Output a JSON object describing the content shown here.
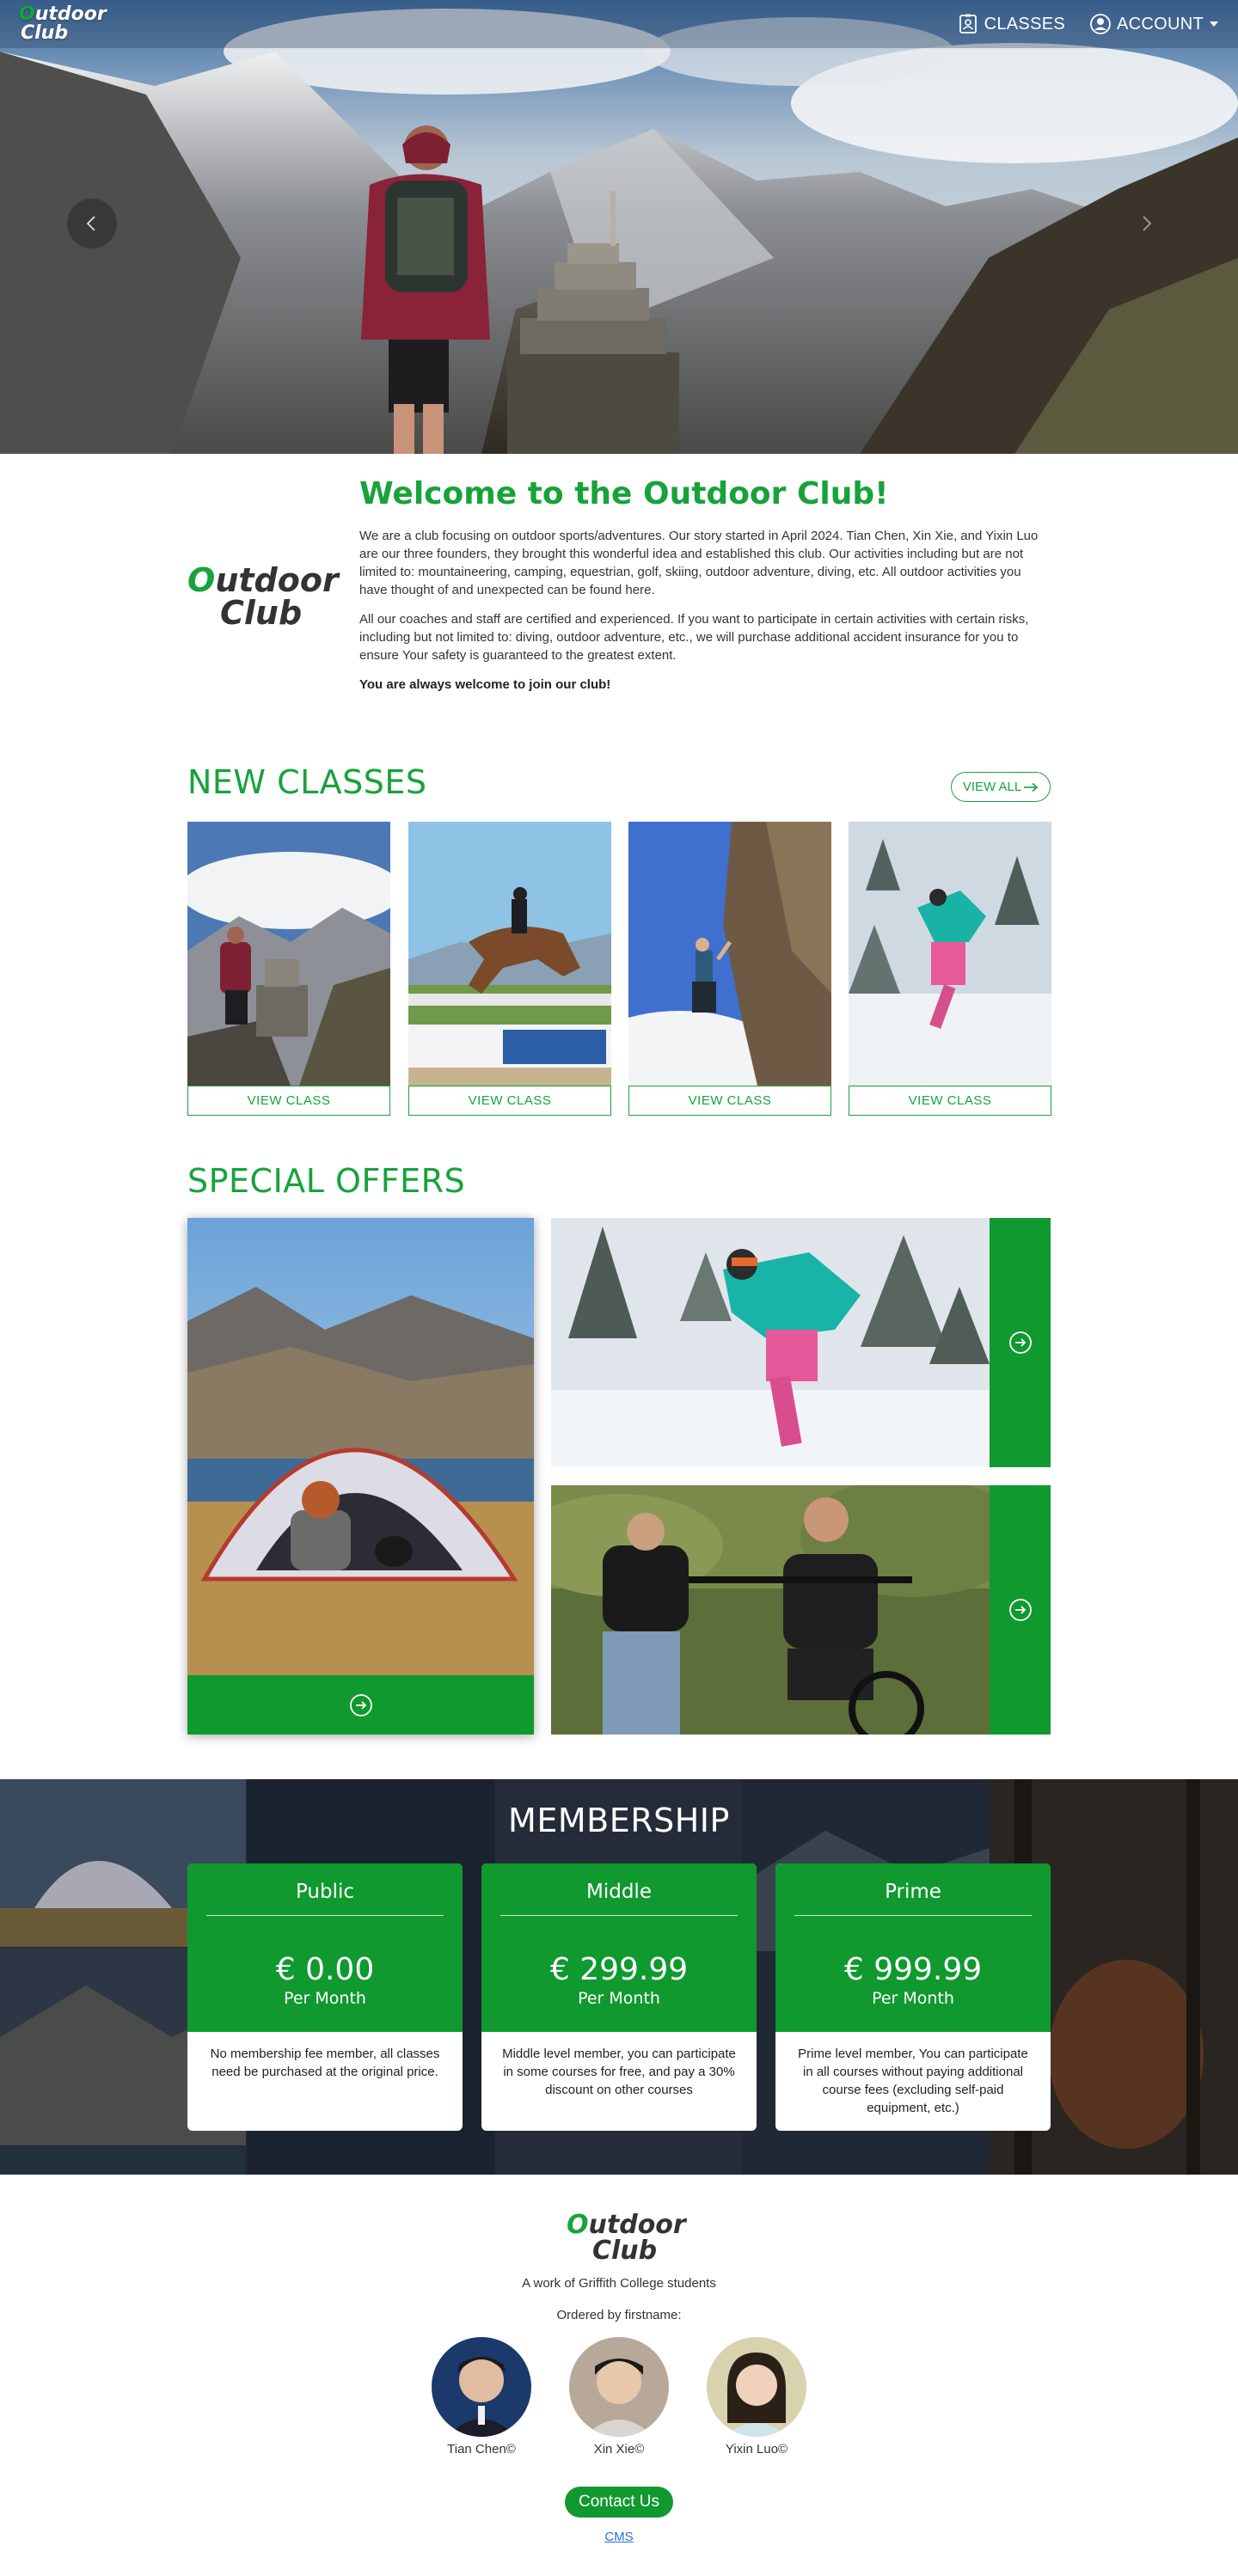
{
  "nav": {
    "logo_line1_first": "O",
    "logo_line1_rest": "utdoor",
    "logo_line2": "Club",
    "classes_label": "CLASSES",
    "account_label": "ACCOUNT",
    "classes_icon": "id-badge-icon",
    "account_icon": "user-circle-icon",
    "account_caret_icon": "caret-down-icon"
  },
  "hero": {
    "prev_icon": "chevron-left-icon",
    "next_icon": "chevron-right-icon"
  },
  "welcome": {
    "title": "Welcome to the Outdoor Club!",
    "paragraph1": "We are a club focusing on outdoor sports/adventures. Our story started in April 2024. Tian Chen, Xin Xie, and Yixin Luo are our three founders, they brought this wonderful idea and established this club. Our activities including but are not limited to: mountaineering, camping, equestrian, golf, skiing, outdoor adventure, diving, etc. All outdoor activities you have thought of and unexpected can be found here.",
    "paragraph2": "All our coaches and staff are certified and experienced. If you want to participate in certain activities with certain risks, including but not limited to: diving, outdoor adventure, etc., we will purchase additional accident insurance for you to ensure Your safety is guaranteed to the greatest extent.",
    "paragraph3": "You are always welcome to join our club!",
    "logo_line1_first": "O",
    "logo_line1_rest": "utdoor",
    "logo_line2": "Club"
  },
  "new_classes": {
    "title": "NEW CLASSES",
    "view_all_label": "VIEW ALL",
    "view_all_icon": "arrow-right-icon",
    "cards": [
      {
        "button_label": "VIEW CLASS"
      },
      {
        "button_label": "VIEW CLASS"
      },
      {
        "button_label": "VIEW CLASS"
      },
      {
        "button_label": "VIEW CLASS"
      }
    ]
  },
  "special_offers": {
    "title": "SPECIAL OFFERS",
    "arrow_icon": "arrow-circle-right-icon"
  },
  "membership": {
    "title": "MEMBERSHIP",
    "plans": [
      {
        "name": "Public",
        "price": "€ 0.00",
        "period": "Per Month",
        "description": "No membership fee member, all classes need be purchased at the original price."
      },
      {
        "name": "Middle",
        "price": "€ 299.99",
        "period": "Per Month",
        "description": "Middle level member, you can participate in some courses for free, and pay a 30% discount on other courses"
      },
      {
        "name": "Prime",
        "price": "€ 999.99",
        "period": "Per Month",
        "description": "Prime level member, You can participate in all courses without paying additional course fees (excluding self-paid equipment, etc.)"
      }
    ]
  },
  "footer": {
    "logo_line1_first": "O",
    "logo_line1_rest": "utdoor",
    "logo_line2": "Club",
    "tagline": "A work of Griffith College students",
    "ordered_by": "Ordered by firstname:",
    "people": [
      {
        "name": "Tian Chen©"
      },
      {
        "name": "Xin Xie©"
      },
      {
        "name": "Yixin Luo©"
      }
    ],
    "contact_label": "Contact Us",
    "cms_label": "CMS"
  },
  "colors": {
    "brand_green": "#17a33a",
    "offer_green": "#0f992f",
    "link_blue": "#2a6fd6"
  }
}
